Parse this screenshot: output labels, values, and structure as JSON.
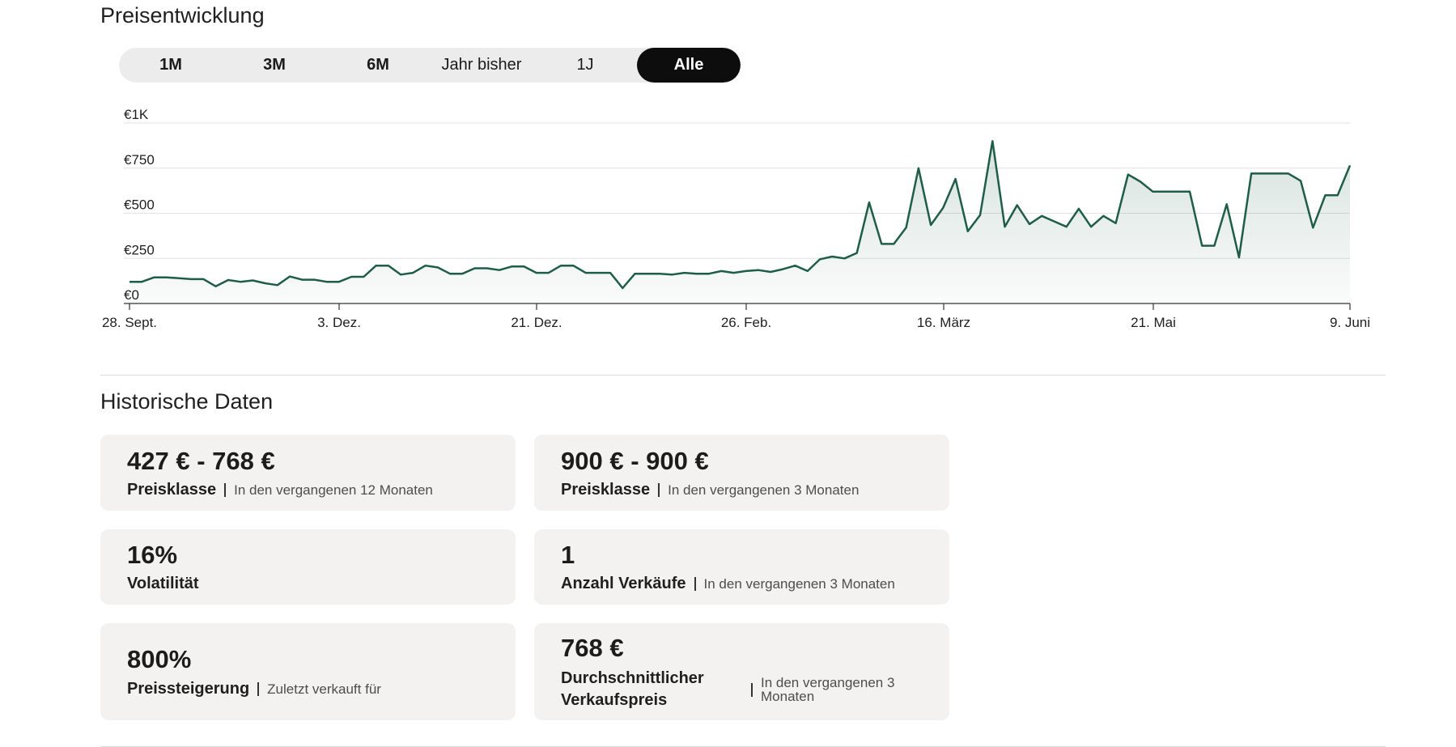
{
  "price_section": {
    "title": "Preisentwicklung",
    "ranges": [
      "1M",
      "3M",
      "6M",
      "Jahr bisher",
      "1J",
      "Alle"
    ],
    "active_range": "Alle"
  },
  "chart_data": {
    "type": "area",
    "y_ticks": [
      "€1K",
      "€750",
      "€500",
      "€250",
      "€0"
    ],
    "x_ticks": [
      "28. Sept.",
      "3. Dez.",
      "21. Dez.",
      "26. Feb.",
      "16. März",
      "21. Mai",
      "9. Juni"
    ],
    "ylim": [
      0,
      1000
    ],
    "grid": true,
    "line_color": "#1e5e47",
    "series": [
      {
        "values": [
          120,
          120,
          145,
          145,
          140,
          135,
          135,
          95,
          130,
          120,
          128,
          112,
          102,
          150,
          132,
          132,
          120,
          120,
          148,
          148,
          210,
          210,
          160,
          170,
          210,
          200,
          165,
          165,
          195,
          195,
          185,
          205,
          205,
          170,
          170,
          210,
          210,
          170,
          170,
          170,
          85,
          165,
          165,
          165,
          160,
          170,
          165,
          165,
          180,
          170,
          180,
          185,
          175,
          190,
          210,
          180,
          245,
          260,
          250,
          280,
          560,
          330,
          330,
          420,
          750,
          435,
          530,
          690,
          400,
          490,
          900,
          425,
          545,
          440,
          485,
          455,
          425,
          525,
          425,
          485,
          445,
          715,
          675,
          620,
          620,
          620,
          620,
          320,
          320,
          550,
          255,
          720,
          720,
          720,
          720,
          680,
          420,
          600,
          600,
          765
        ]
      }
    ]
  },
  "history_section": {
    "title": "Historische Daten",
    "cards": [
      {
        "value": "427 € - 768 €",
        "label": "Preisklasse",
        "sub": "In den vergangenen 12 Monaten"
      },
      {
        "value": "900 € - 900 €",
        "label": "Preisklasse",
        "sub": "In den vergangenen 3 Monaten"
      },
      {
        "value": "16%",
        "label": "Volatilität",
        "sub": ""
      },
      {
        "value": "1",
        "label": "Anzahl Verkäufe",
        "sub": "In den vergangenen 3 Monaten"
      },
      {
        "value": "800%",
        "label": "Preissteigerung",
        "sub": "Zuletzt verkauft für"
      },
      {
        "value": "768 €",
        "label": "Durchschnittlicher Verkaufspreis",
        "sub": "In den vergangenen 3 Monaten"
      }
    ]
  }
}
